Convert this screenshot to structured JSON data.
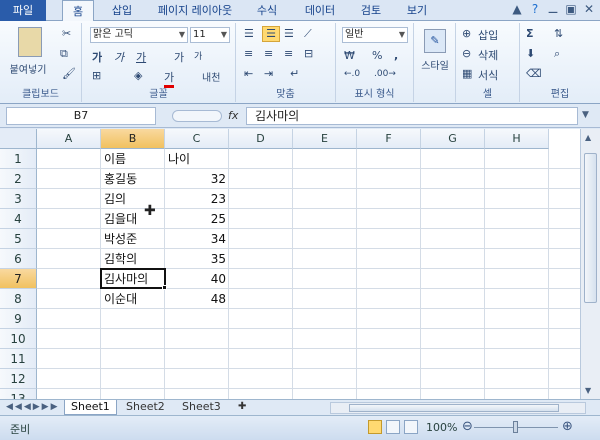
{
  "tabs": [
    "파일",
    "홈",
    "삽입",
    "페이지 레이아웃",
    "수식",
    "데이터",
    "검토",
    "보기"
  ],
  "window_buttons": [
    "▲",
    "?",
    "⚊",
    "▣",
    "✕"
  ],
  "ribbon": {
    "clipboard": {
      "paste_label": "붙여넣기",
      "group_label": "클립보드"
    },
    "font": {
      "font_name": "맑은 고딕",
      "font_size": "11",
      "bold": "가",
      "italic": "가",
      "underline": "가",
      "grow": "가",
      "shrink": "가",
      "color_a": "가",
      "phonetic": "내천",
      "group_label": "글꼴"
    },
    "alignment": {
      "group_label": "맞춤"
    },
    "number": {
      "format": "일반",
      "group_label": "표시 형식",
      "percent": "%",
      "comma": ","
    },
    "styles": {
      "label": "스타일",
      "group_label": ""
    },
    "cells": {
      "insert": "삽입",
      "delete": "삭제",
      "format": "서식",
      "group_label": "셀"
    },
    "editing": {
      "group_label": "편집"
    }
  },
  "formula_bar": {
    "name_box": "B7",
    "fx": "fx",
    "content": "김사마의"
  },
  "columns": [
    "A",
    "B",
    "C",
    "D",
    "E",
    "F",
    "G",
    "H"
  ],
  "rows": [
    "1",
    "2",
    "3",
    "4",
    "5",
    "6",
    "7",
    "8",
    "9",
    "10",
    "11",
    "12",
    "13"
  ],
  "cells": {
    "B1": "이름",
    "C1": "나이",
    "B2": "홍길동",
    "C2": "32",
    "B3": "김의",
    "C3": "23",
    "B4": "김을대",
    "C4": "25",
    "B5": "박성준",
    "C5": "34",
    "B6": "김학의",
    "C6": "35",
    "B7": "김사마의",
    "C7": "40",
    "B8": "이순대",
    "C8": "48"
  },
  "sheets": [
    "Sheet1",
    "Sheet2",
    "Sheet3"
  ],
  "status": {
    "ready": "준비",
    "zoom": "100%",
    "zoom_level_percent": 100
  }
}
